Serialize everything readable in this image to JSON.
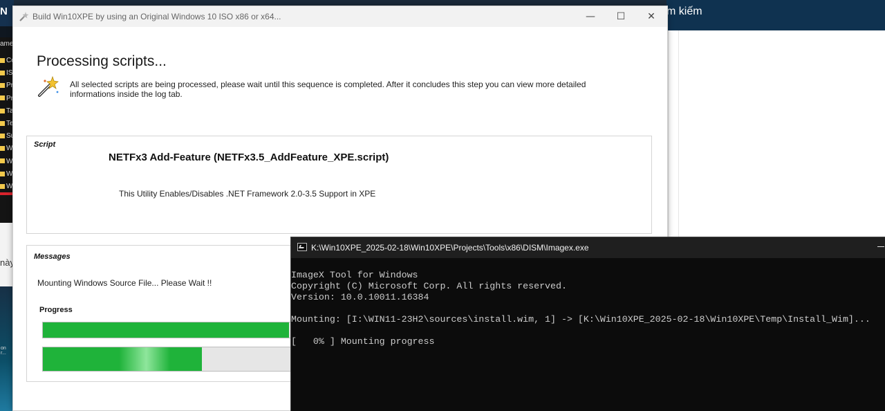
{
  "background": {
    "left_header": "N",
    "left_column_label": "ame",
    "left_rows": [
      "Co",
      "IS",
      "Pr",
      "Pr",
      "Ta",
      "Te",
      "Su",
      "W",
      "W",
      "W",
      "W"
    ],
    "left_white_text": "này",
    "left_desktop_text": "on\nr...",
    "top_bar_text": "m kiếm"
  },
  "dialog": {
    "title": "Build Win10XPE by using an Original Windows 10 ISO x86 or x64...",
    "minimize_glyph": "—",
    "maximize_glyph": "☐",
    "close_glyph": "✕",
    "heading": "Processing scripts...",
    "description": "All selected scripts are being processed, please wait until this sequence is completed. After it concludes this step you can view more detailed informations inside the log tab.",
    "script_group_label": "Script",
    "script_title": "NETFx3 Add-Feature (NETFx3.5_AddFeature_XPE.script)",
    "script_description": "This Utility Enables/Disables .NET Framework 2.0-3.5 Support in XPE",
    "messages_group_label": "Messages",
    "message": "Mounting Windows Source File... Please Wait !!",
    "progress_label": "Progress",
    "progress_overall": 0.41,
    "progress_current": 0.265,
    "colors": {
      "progress_fill": "#1fb33a",
      "progress_track": "#e6e6e6"
    }
  },
  "console": {
    "title": "K:\\Win10XPE_2025-02-18\\Win10XPE\\Projects\\Tools\\x86\\DISM\\Imagex.exe",
    "lines": [
      "ImageX Tool for Windows",
      "Copyright (C) Microsoft Corp. All rights reserved.",
      "Version: 10.0.10011.16384",
      "",
      "Mounting: [I:\\WIN11-23H2\\sources\\install.wim, 1] -> [K:\\Win10XPE_2025-02-18\\Win10XPE\\Temp\\Install_Wim]...",
      "",
      "[   0% ] Mounting progress"
    ]
  }
}
